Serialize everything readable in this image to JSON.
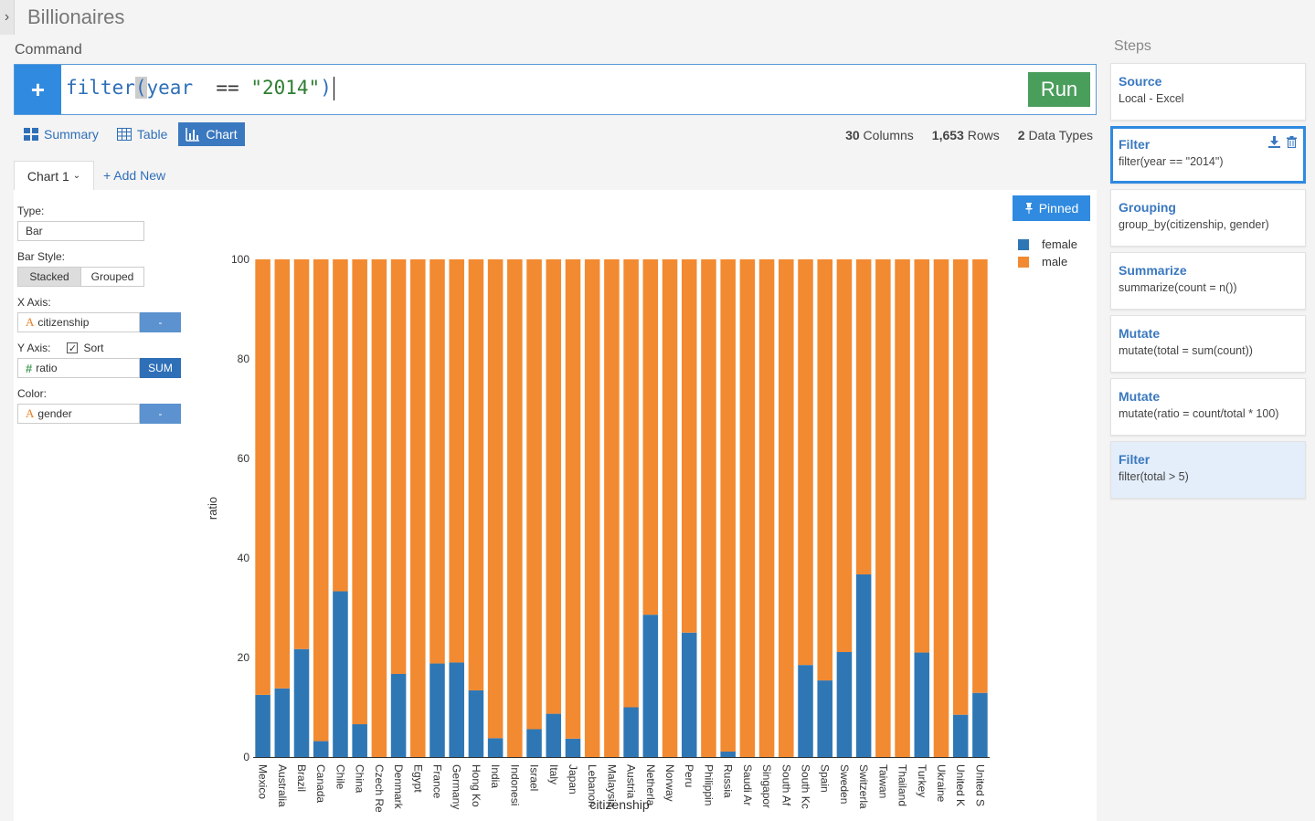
{
  "app": {
    "title": "Billionaires",
    "command_label": "Command"
  },
  "command": {
    "fn": "filter",
    "open_paren": "(",
    "arg": "year",
    "op": "==",
    "value": "\"2014\"",
    "close_paren": ")",
    "run_label": "Run"
  },
  "views": {
    "summary": "Summary",
    "table": "Table",
    "chart": "Chart"
  },
  "stats": {
    "columns_count": "30",
    "columns_label": "Columns",
    "rows_count": "1,653",
    "rows_label": "Rows",
    "types_count": "2",
    "types_label": "Data Types"
  },
  "chart_tab": {
    "label": "Chart 1",
    "add_new": "+ Add New"
  },
  "controls": {
    "type_label": "Type:",
    "type_value": "Bar",
    "bar_style_label": "Bar Style:",
    "stacked": "Stacked",
    "grouped": "Grouped",
    "x_axis_label": "X Axis:",
    "x_axis_value": "citizenship",
    "x_axis_btn": "-",
    "y_axis_label": "Y Axis:",
    "sort_label": "Sort",
    "y_axis_value": "ratio",
    "y_axis_btn": "SUM",
    "color_label": "Color:",
    "color_value": "gender",
    "color_btn": "-"
  },
  "pinned_label": "Pinned",
  "chart_data": {
    "type": "bar",
    "stacked": true,
    "xlabel": "citizenship",
    "ylabel": "ratio",
    "ylim": [
      0,
      100
    ],
    "yticks": [
      "0",
      "20",
      "40",
      "60",
      "80",
      "100"
    ],
    "legend": "top-right",
    "categories": [
      "Mexico",
      "Australia",
      "Brazil",
      "Canada",
      "Chile",
      "China",
      "Czech Re",
      "Denmark",
      "Egypt",
      "France",
      "Germany",
      "Hong Ko",
      "India",
      "Indonesi",
      "Israel",
      "Italy",
      "Japan",
      "Lebanon",
      "Malaysia",
      "Austria",
      "Netherla",
      "Norway",
      "Peru",
      "Philippin",
      "Russia",
      "Saudi Ar",
      "Singapor",
      "South Af",
      "South Kc",
      "Spain",
      "Sweden",
      "Switzerla",
      "Taiwan",
      "Thailand",
      "Turkey",
      "Ukraine",
      "United K",
      "United S"
    ],
    "series": [
      {
        "name": "female",
        "color": "#2f77b4",
        "values": [
          12.5,
          13.8,
          21.7,
          3.2,
          33.3,
          6.6,
          0,
          16.7,
          0,
          18.8,
          19.0,
          13.4,
          3.8,
          0,
          5.6,
          8.7,
          3.7,
          0,
          0,
          10.0,
          28.6,
          0,
          25.0,
          0,
          1.1,
          0,
          0,
          0,
          18.5,
          15.4,
          21.1,
          36.7,
          0,
          0,
          21.0,
          0,
          8.5,
          12.9
        ]
      },
      {
        "name": "male",
        "color": "#f28a31",
        "values": [
          87.5,
          86.2,
          78.3,
          96.8,
          66.7,
          93.4,
          100,
          83.3,
          100,
          81.2,
          81.0,
          86.6,
          96.2,
          100,
          94.4,
          91.3,
          96.3,
          100,
          100,
          90.0,
          71.4,
          100,
          75.0,
          100,
          98.9,
          100,
          100,
          100,
          81.5,
          84.6,
          78.9,
          63.3,
          100,
          100,
          79.0,
          100,
          91.5,
          87.1
        ]
      }
    ]
  },
  "steps": {
    "title": "Steps",
    "items": [
      {
        "name": "Source",
        "desc": "Local - Excel"
      },
      {
        "name": "Filter",
        "desc": "filter(year == \"2014\")"
      },
      {
        "name": "Grouping",
        "desc": "group_by(citizenship, gender)"
      },
      {
        "name": "Summarize",
        "desc": "summarize(count = n())"
      },
      {
        "name": "Mutate",
        "desc": "mutate(total = sum(count))"
      },
      {
        "name": "Mutate",
        "desc": "mutate(ratio = count/total * 100)"
      },
      {
        "name": "Filter",
        "desc": "filter(total > 5)"
      }
    ]
  }
}
